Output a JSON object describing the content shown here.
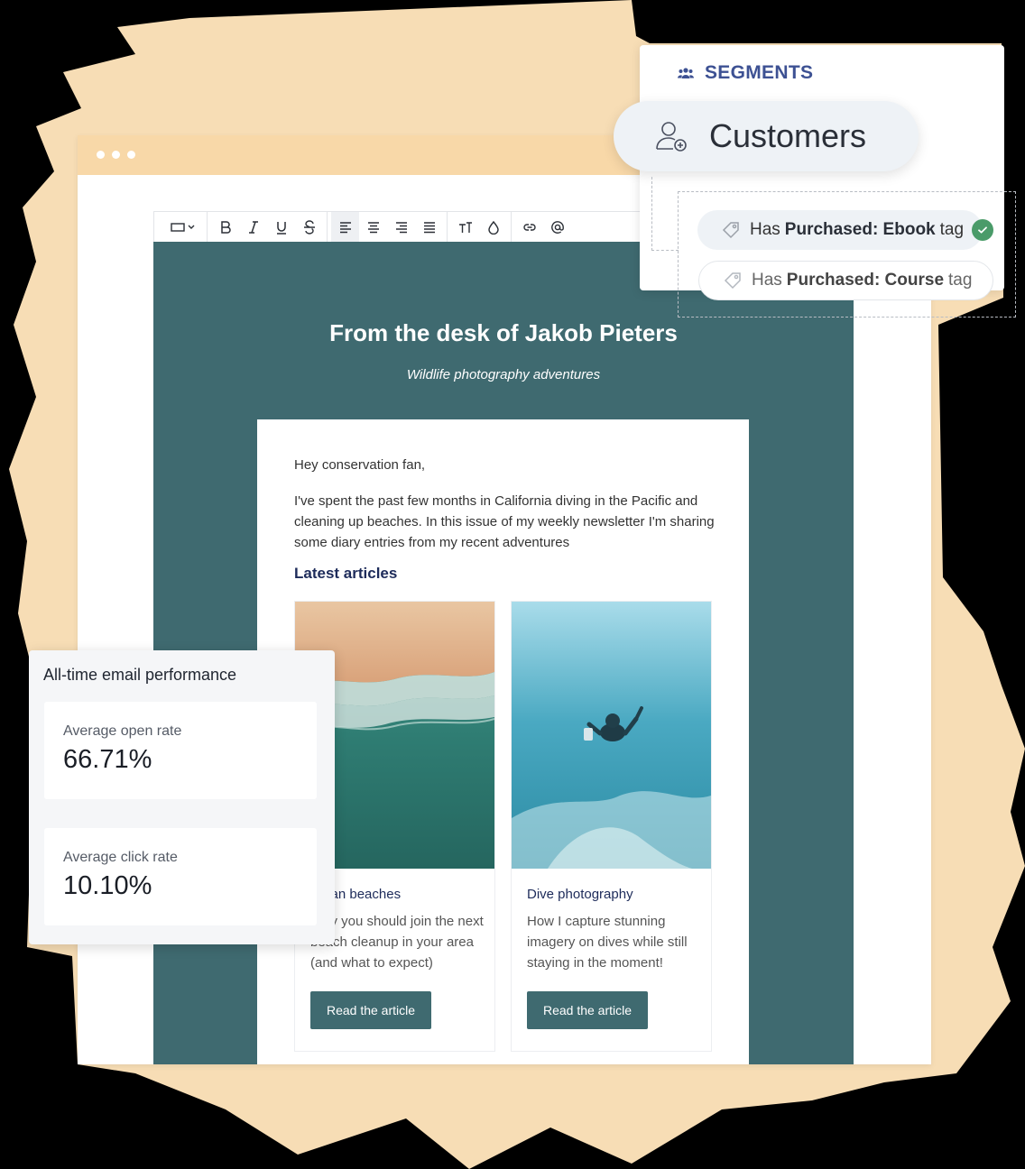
{
  "segments": {
    "heading": "SEGMENTS",
    "selected_segment": "Customers",
    "tags": [
      {
        "prefix": "Has",
        "name": "Purchased: Ebook",
        "suffix": "tag",
        "checked": true
      },
      {
        "prefix": "Has",
        "name": "Purchased: Course",
        "suffix": "tag",
        "checked": false
      }
    ]
  },
  "toolbar": {
    "buttons": [
      "block-type",
      "bold",
      "italic",
      "underline",
      "strikethrough",
      "align-left",
      "align-center",
      "align-right",
      "justify",
      "text-size",
      "text-color",
      "link",
      "mention"
    ]
  },
  "email": {
    "title": "From the desk of Jakob Pieters",
    "subtitle": "Wildlife photography adventures",
    "greeting": "Hey conservation fan,",
    "intro": "I've spent the past few months in California diving in the Pacific and cleaning up beaches. In this issue of my weekly newsletter I'm sharing some diary entries from my recent adventures",
    "section_heading": "Latest articles",
    "articles": [
      {
        "title": "Clean beaches",
        "text": "Why you should join the next beach cleanup in your area (and what to expect)",
        "button": "Read the article"
      },
      {
        "title": "Dive photography",
        "text": "How I capture stunning imagery on dives while still staying in the moment!",
        "button": "Read the article"
      }
    ]
  },
  "performance": {
    "title": "All-time email performance",
    "open_rate_label": "Average open rate",
    "open_rate_value": "66.71%",
    "click_rate_label": "Average click rate",
    "click_rate_value": "10.10%"
  },
  "colors": {
    "email_background": "#3f6a70",
    "accent_peach": "#f8d8a8",
    "segments_blue": "#3d5193",
    "check_green": "#4a9b69"
  }
}
